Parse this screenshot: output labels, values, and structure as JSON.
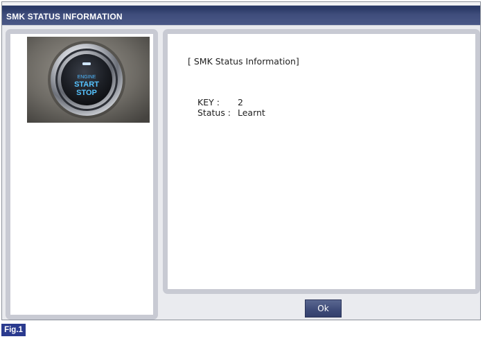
{
  "window": {
    "title": "SMK STATUS INFORMATION"
  },
  "image_panel": {
    "button_photo": {
      "icon": "engine-start-stop-button",
      "line1": "ENGINE",
      "line2": "START",
      "line3": "STOP"
    }
  },
  "info_panel": {
    "heading": "[ SMK Status Information]",
    "rows": [
      {
        "label": "KEY :",
        "value": "2"
      },
      {
        "label": "Status :",
        "value": "Learnt"
      }
    ]
  },
  "actions": {
    "ok_label": "Ok"
  },
  "figure_label": "Fig.1",
  "colors": {
    "title_bar": "#3f4d7c",
    "panel_border": "#c8cad3",
    "button": "#3d4a78",
    "figure_label_bg": "#2a3a8e",
    "button_glow": "#3fb6ff"
  }
}
